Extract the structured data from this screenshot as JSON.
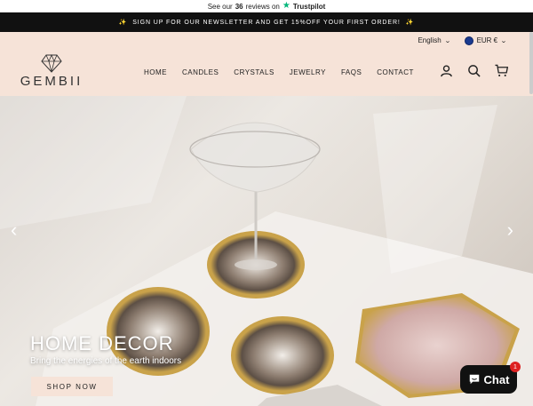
{
  "trustpilot": {
    "prefix": "See our",
    "count": "36",
    "suffix": "reviews on",
    "brand": "Trustpilot",
    "star_icon": "star-icon"
  },
  "announcement": {
    "emoji": "✨",
    "text": "SIGN UP FOR OUR NEWSLETTER AND GET 15%OFF YOUR FIRST ORDER!"
  },
  "utility": {
    "language": "English",
    "currency": "EUR €"
  },
  "header": {
    "logo_text": "GEMBII",
    "nav": [
      "HOME",
      "CANDLES",
      "CRYSTALS",
      "JEWELRY",
      "FAQS",
      "CONTACT"
    ],
    "icons": [
      "user-icon",
      "search-icon",
      "cart-icon"
    ]
  },
  "hero": {
    "title": "HOME DECOR",
    "subtitle": "Bring the energies of the earth indoors",
    "cta": "SHOP NOW"
  },
  "chat": {
    "label": "Chat",
    "badge": "1"
  },
  "colors": {
    "accent": "#f6e3d8",
    "announce_bg": "#111111",
    "trustpilot": "#00b67a"
  }
}
